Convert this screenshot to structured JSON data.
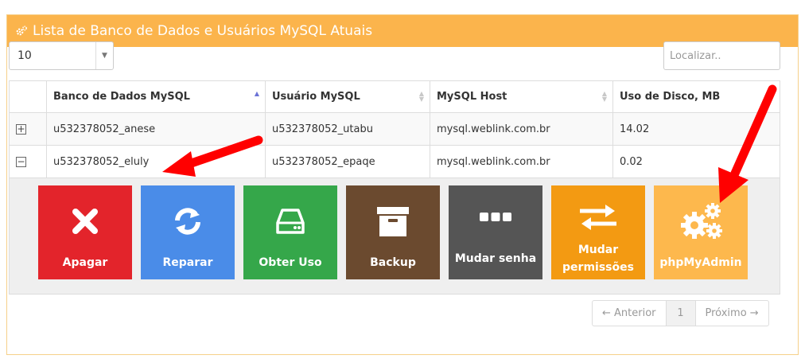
{
  "panel": {
    "title": "Lista de Banco de Dados e Usuários MySQL Atuais",
    "title_icon": "gears-icon"
  },
  "length_select": {
    "value": "10"
  },
  "search": {
    "placeholder": "Localizar.."
  },
  "table": {
    "columns": [
      "Banco de Dados MySQL",
      "Usuário MySQL",
      "MySQL Host",
      "Uso de Disco, MB"
    ],
    "rows": [
      {
        "expander": "+",
        "database": "u532378052_anese",
        "user": "u532378052_utabu",
        "host": "mysql.weblink.com.br",
        "disk": "14.02"
      },
      {
        "expander": "−",
        "database": "u532378052_eluly",
        "user": "u532378052_epaqe",
        "host": "mysql.weblink.com.br",
        "disk": "0.02"
      }
    ]
  },
  "actions": [
    {
      "label": "Apagar",
      "icon": "times-icon",
      "color": "#e3242b"
    },
    {
      "label": "Reparar",
      "icon": "refresh-icon",
      "color": "#4a8ce8"
    },
    {
      "label": "Obter Uso",
      "icon": "hdd-icon",
      "color": "#35a74a"
    },
    {
      "label": "Backup",
      "icon": "archive-icon",
      "color": "#6b4a2f"
    },
    {
      "label": "Mudar senha",
      "icon": "ellipsis-icon",
      "color": "#555555"
    },
    {
      "label": "Mudar permissões",
      "icon": "exchange-icon",
      "color": "#f39a12"
    },
    {
      "label": "phpMyAdmin",
      "icon": "gears-icon",
      "color": "#fdb84d"
    }
  ],
  "pagination": {
    "prev": "← Anterior",
    "page": "1",
    "next": "Próximo →"
  },
  "annotation_color": "#ff0000"
}
